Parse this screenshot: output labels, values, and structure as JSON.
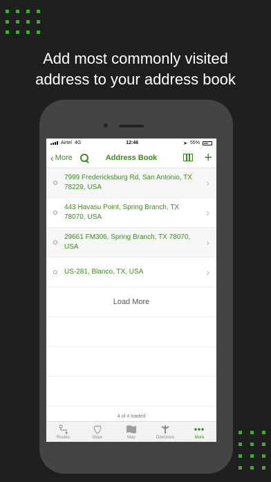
{
  "headline": {
    "line1": "Add most commonly visited",
    "line2": "address to your address book"
  },
  "statusbar": {
    "carrier": "Airtel",
    "network": "4G",
    "time": "12:46",
    "battery": "55%"
  },
  "navbar": {
    "back_label": "More",
    "title": "Address Book"
  },
  "addresses": [
    "7999 Fredericksburg Rd, San Antonio, TX 78229, USA",
    "443 Havasu Point, Spring Branch, TX 78070, USA",
    "29661 FM306, Spring Branch, TX 78070, USA",
    "US-281, Blanco, TX, USA"
  ],
  "load_more": "Load More",
  "count_label": "4 of 4 loaded",
  "tabs": [
    {
      "label": "Routes",
      "icon": "routes-icon"
    },
    {
      "label": "Stops",
      "icon": "stops-icon"
    },
    {
      "label": "Map",
      "icon": "map-icon"
    },
    {
      "label": "Directions",
      "icon": "directions-icon"
    },
    {
      "label": "More",
      "icon": "more-icon",
      "active": true
    }
  ],
  "colors": {
    "accent": "#3b8a1e",
    "brand_green": "#3fae2a",
    "background": "#1f1f1f"
  }
}
